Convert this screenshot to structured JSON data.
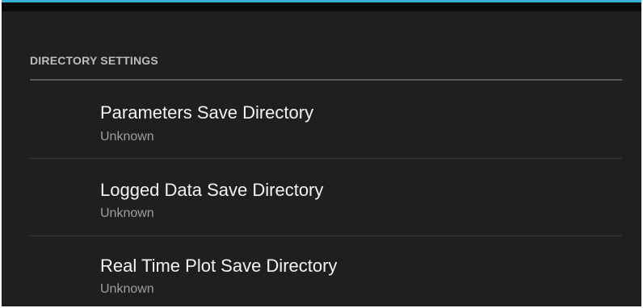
{
  "section": {
    "title": "DIRECTORY SETTINGS"
  },
  "preferences": [
    {
      "title": "Parameters Save Directory",
      "summary": "Unknown"
    },
    {
      "title": "Logged Data Save Directory",
      "summary": "Unknown"
    },
    {
      "title": "Real Time Plot Save Directory",
      "summary": "Unknown"
    }
  ],
  "colors": {
    "background": "#1f1f21",
    "accent": "#35b0d6",
    "title_text": "#f3f3f3",
    "summary_text": "#9e9e9e"
  }
}
